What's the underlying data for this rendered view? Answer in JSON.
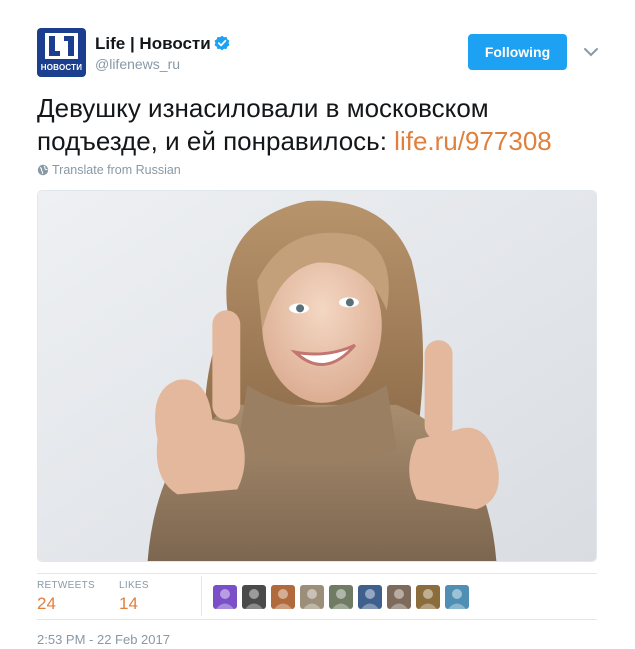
{
  "account": {
    "avatar_text": "НОВОСТИ",
    "display_name": "Life | Новости",
    "handle": "@lifenews_ru",
    "verified": true
  },
  "follow_button": {
    "label": "Following"
  },
  "tweet": {
    "text": "Девушку изнасиловали в московском подъезде, и ей понравилось: ",
    "link": "life.ru/977308",
    "translate_label": "Translate from Russian"
  },
  "stats": {
    "retweets_label": "RETWEETS",
    "retweets_count": "24",
    "likes_label": "LIKES",
    "likes_count": "14"
  },
  "likers": [
    {
      "name": "liker-1",
      "color": "#7a4fc8"
    },
    {
      "name": "liker-2",
      "color": "#4a4a4a"
    },
    {
      "name": "liker-3",
      "color": "#b06a3c"
    },
    {
      "name": "liker-4",
      "color": "#9c8f7a"
    },
    {
      "name": "liker-5",
      "color": "#6f7b63"
    },
    {
      "name": "liker-6",
      "color": "#3f5f8c"
    },
    {
      "name": "liker-7",
      "color": "#7d6a5b"
    },
    {
      "name": "liker-8",
      "color": "#8a6d3b"
    },
    {
      "name": "liker-9",
      "color": "#4e8fb3"
    }
  ],
  "timestamp": "2:53 PM - 22 Feb 2017",
  "colors": {
    "accent": "#e0803d",
    "follow_blue": "#1da1f2",
    "verified_blue": "#1da1f2",
    "muted": "#8899a6"
  }
}
